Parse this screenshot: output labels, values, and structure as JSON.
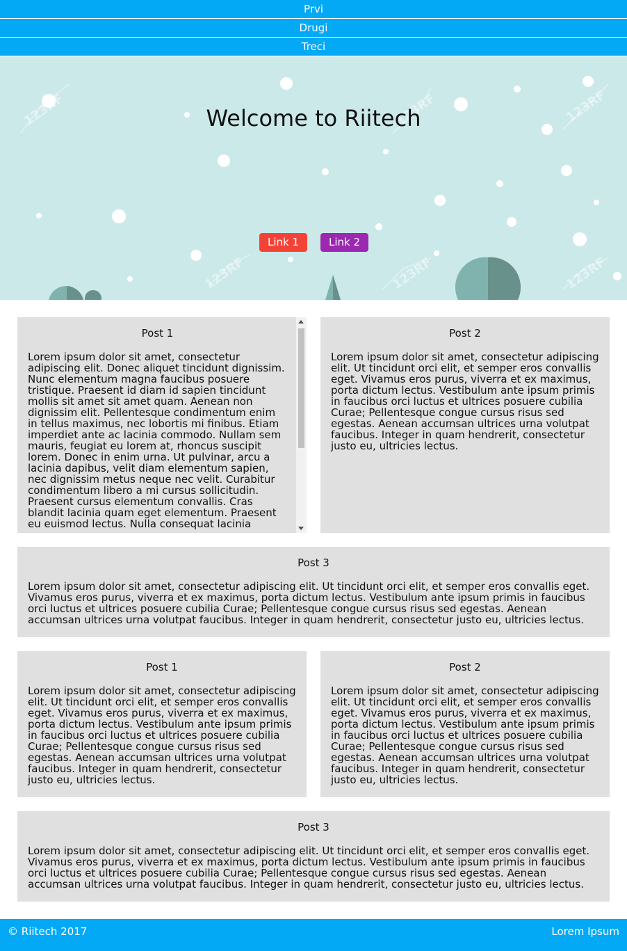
{
  "nav": {
    "items": [
      {
        "label": "Prvi"
      },
      {
        "label": "Drugi"
      },
      {
        "label": "Treci"
      }
    ]
  },
  "hero": {
    "title": "Welcome to Riitech",
    "link1": "Link 1",
    "link2": "Link 2",
    "watermark": "123RF"
  },
  "posts": [
    {
      "title": "Post 1",
      "body": "Lorem ipsum dolor sit amet, consectetur adipiscing elit. Donec aliquet tincidunt dignissim. Nunc elementum magna faucibus posuere tristique. Praesent id diam id sapien tincidunt mollis sit amet sit amet quam. Aenean non dignissim elit. Pellentesque condimentum enim in tellus maximus, nec lobortis mi finibus. Etiam imperdiet ante ac lacinia commodo. Nullam sem mauris, feugiat eu lorem at, rhoncus suscipit lorem. Donec in enim urna. Ut pulvinar, arcu a lacinia dapibus, velit diam elementum sapien, nec dignissim metus neque nec velit. Curabitur condimentum libero a mi cursus sollicitudin. Praesent cursus elementum convallis. Cras blandit lacinia quam eget elementum. Praesent eu euismod lectus. Nulla consequat lacinia"
    },
    {
      "title": "Post 2",
      "body": "Lorem ipsum dolor sit amet, consectetur adipiscing elit. Ut tincidunt orci elit, et semper eros convallis eget. Vivamus eros purus, viverra et ex maximus, porta dictum lectus. Vestibulum ante ipsum primis in faucibus orci luctus et ultrices posuere cubilia Curae; Pellentesque congue cursus risus sed egestas. Aenean accumsan ultrices urna volutpat faucibus. Integer in quam hendrerit, consectetur justo eu, ultricies lectus."
    },
    {
      "title": "Post 3",
      "body": "Lorem ipsum dolor sit amet, consectetur adipiscing elit. Ut tincidunt orci elit, et semper eros convallis eget. Vivamus eros purus, viverra et ex maximus, porta dictum lectus. Vestibulum ante ipsum primis in faucibus orci luctus et ultrices posuere cubilia Curae; Pellentesque congue cursus risus sed egestas. Aenean accumsan ultrices urna volutpat faucibus. Integer in quam hendrerit, consectetur justo eu, ultricies lectus."
    },
    {
      "title": "Post 1",
      "body": "Lorem ipsum dolor sit amet, consectetur adipiscing elit. Ut tincidunt orci elit, et semper eros convallis eget. Vivamus eros purus, viverra et ex maximus, porta dictum lectus. Vestibulum ante ipsum primis in faucibus orci luctus et ultrices posuere cubilia Curae; Pellentesque congue cursus risus sed egestas. Aenean accumsan ultrices urna volutpat faucibus. Integer in quam hendrerit, consectetur justo eu, ultricies lectus."
    },
    {
      "title": "Post 2",
      "body": "Lorem ipsum dolor sit amet, consectetur adipiscing elit. Ut tincidunt orci elit, et semper eros convallis eget. Vivamus eros purus, viverra et ex maximus, porta dictum lectus. Vestibulum ante ipsum primis in faucibus orci luctus et ultrices posuere cubilia Curae; Pellentesque congue cursus risus sed egestas. Aenean accumsan ultrices urna volutpat faucibus. Integer in quam hendrerit, consectetur justo eu, ultricies lectus."
    },
    {
      "title": "Post 3",
      "body": "Lorem ipsum dolor sit amet, consectetur adipiscing elit. Ut tincidunt orci elit, et semper eros convallis eget. Vivamus eros purus, viverra et ex maximus, porta dictum lectus. Vestibulum ante ipsum primis in faucibus orci luctus et ultrices posuere cubilia Curae; Pellentesque congue cursus risus sed egestas. Aenean accumsan ultrices urna volutpat faucibus. Integer in quam hendrerit, consectetur justo eu, ultricies lectus."
    }
  ],
  "footer": {
    "copyright": "© Riitech 2017",
    "right": "Lorem Ipsum"
  },
  "colors": {
    "nav_bg": "#03a9f4",
    "hero_bg": "#cce9ea",
    "link1_bg": "#f44336",
    "link2_bg": "#9c27b0",
    "card_bg": "#e0e0e0"
  }
}
